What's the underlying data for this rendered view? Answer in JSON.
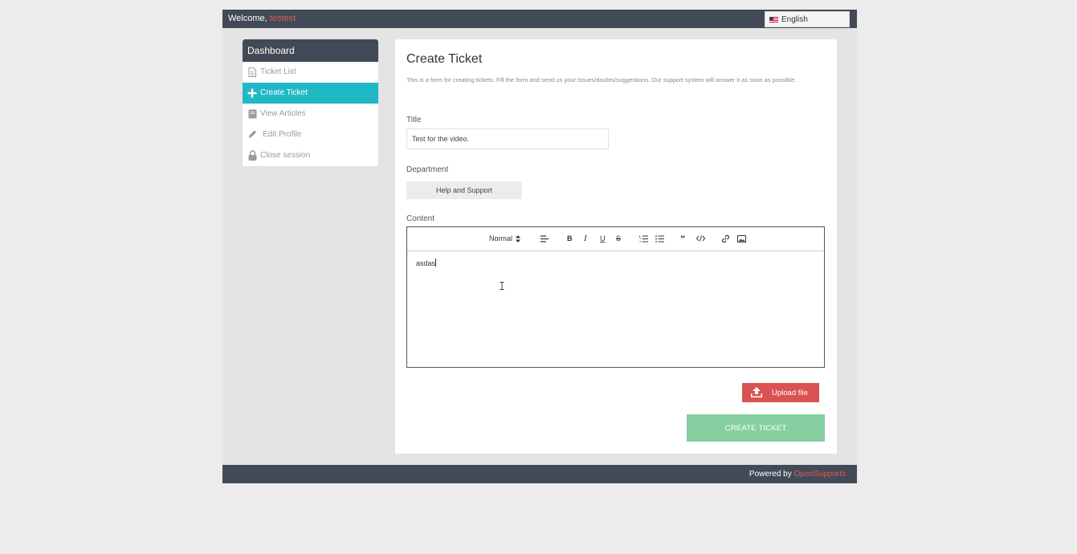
{
  "header": {
    "welcome_label": "Welcome, ",
    "username": "testest",
    "language": "English"
  },
  "sidebar": {
    "title": "Dashboard",
    "items": [
      {
        "label": "Ticket List",
        "icon": "file-text-icon",
        "active": false
      },
      {
        "label": "Create Ticket",
        "icon": "plus-icon",
        "active": true
      },
      {
        "label": "View Articles",
        "icon": "book-icon",
        "active": false
      },
      {
        "label": "Edit Profile",
        "icon": "pencil-icon",
        "active": false
      },
      {
        "label": "Close session",
        "icon": "lock-icon",
        "active": false
      }
    ]
  },
  "form": {
    "heading": "Create Ticket",
    "description": "This is a form for creating tickets. Fill the form and send us your issues/doubts/suggestions. Our support system will answer it as soon as possible.",
    "title_label": "Title",
    "title_value": "Test for the video.",
    "department_label": "Department",
    "department_value": "Help and Support",
    "content_label": "Content",
    "editor": {
      "format_value": "Normal",
      "body_text": "asdas"
    },
    "upload_label": "Upload file",
    "submit_label": "CREATE TICKET"
  },
  "footer": {
    "powered_label": "Powered by ",
    "brand": "OpenSupports"
  },
  "colors": {
    "header_bg": "#414a56",
    "active_item": "#21b8c6",
    "upload_button": "#da5352",
    "submit_button": "#86cfa0",
    "brand_accent": "#e05a5a"
  }
}
